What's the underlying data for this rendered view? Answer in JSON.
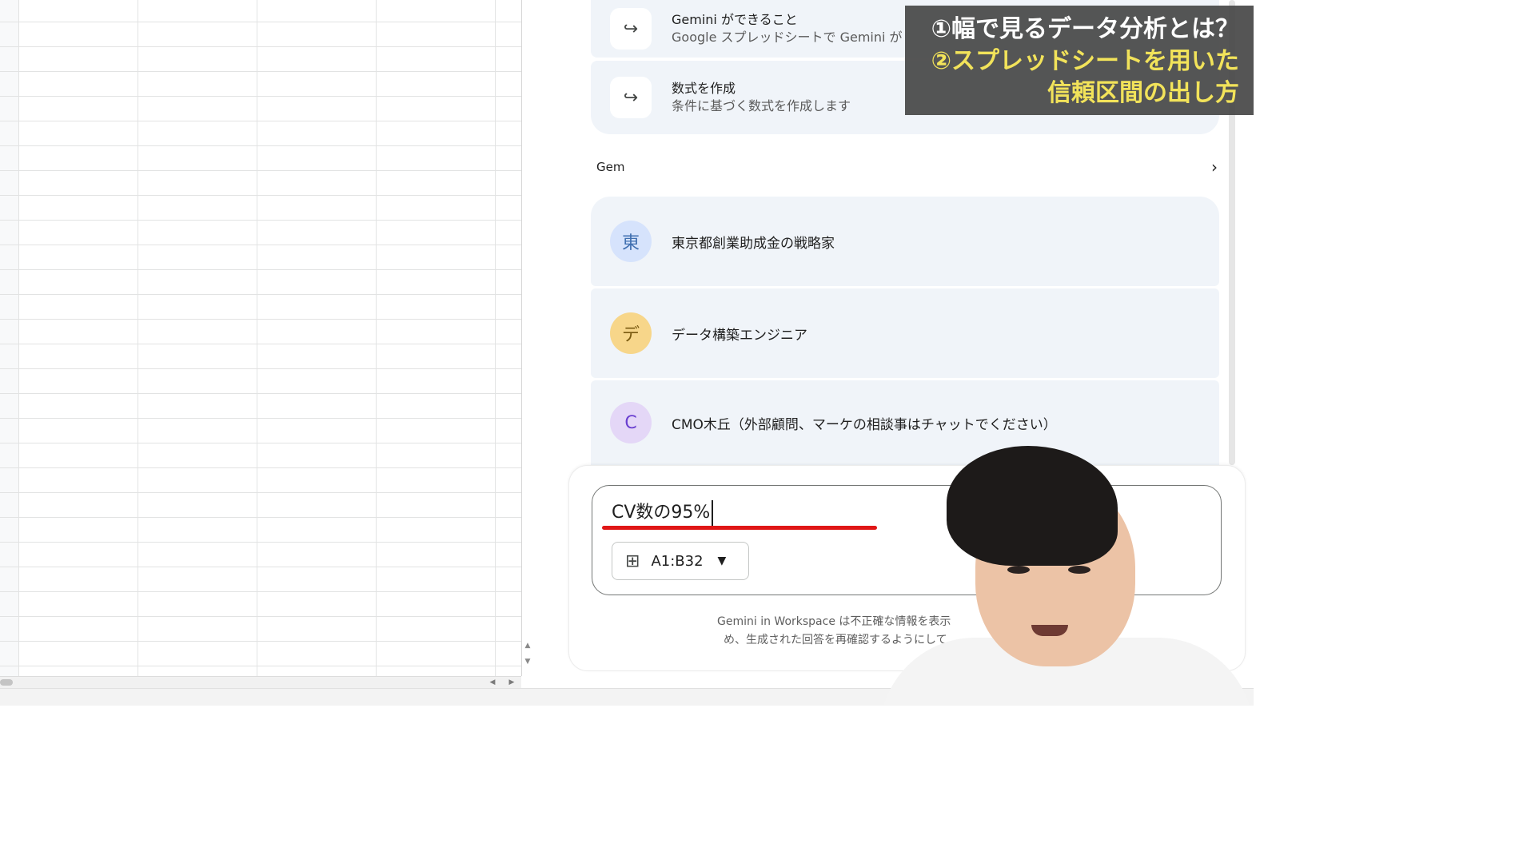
{
  "sheet": {},
  "panel": {
    "suggestions": [
      {
        "icon": "arrow-forward-icon",
        "title": "Gemini ができること",
        "subtitle": "Google スプレッドシートで Gemini が"
      },
      {
        "icon": "arrow-forward-icon",
        "title": "数式を作成",
        "subtitle": "条件に基づく数式を作成します"
      }
    ],
    "gem_section": {
      "label": "Gem"
    },
    "gems": [
      {
        "initial": "東",
        "name": "東京都創業助成金の戦略家",
        "color": "#d6e3fc",
        "text_color": "#3f6fb0"
      },
      {
        "initial": "デ",
        "name": "データ構築エンジニア",
        "color": "#f7d68a",
        "text_color": "#7a5a10"
      },
      {
        "initial": "C",
        "name": "CMO木丘（外部顧問、マーケの相談事はチャットでください）",
        "color": "#e4d7f7",
        "text_color": "#6a3fd0"
      }
    ],
    "compose": {
      "prompt": "CV数の95%",
      "range": "A1:B32"
    },
    "disclaimer": {
      "line1": "Gemini in Workspace は不正確な情報を表示",
      "line2": "め、生成された回答を再確認するようにして"
    }
  },
  "overlay": {
    "line1": "①幅で見るデータ分析とは？",
    "line2": "②スプレッドシートを用いた",
    "line3": "信頼区間の出し方"
  }
}
